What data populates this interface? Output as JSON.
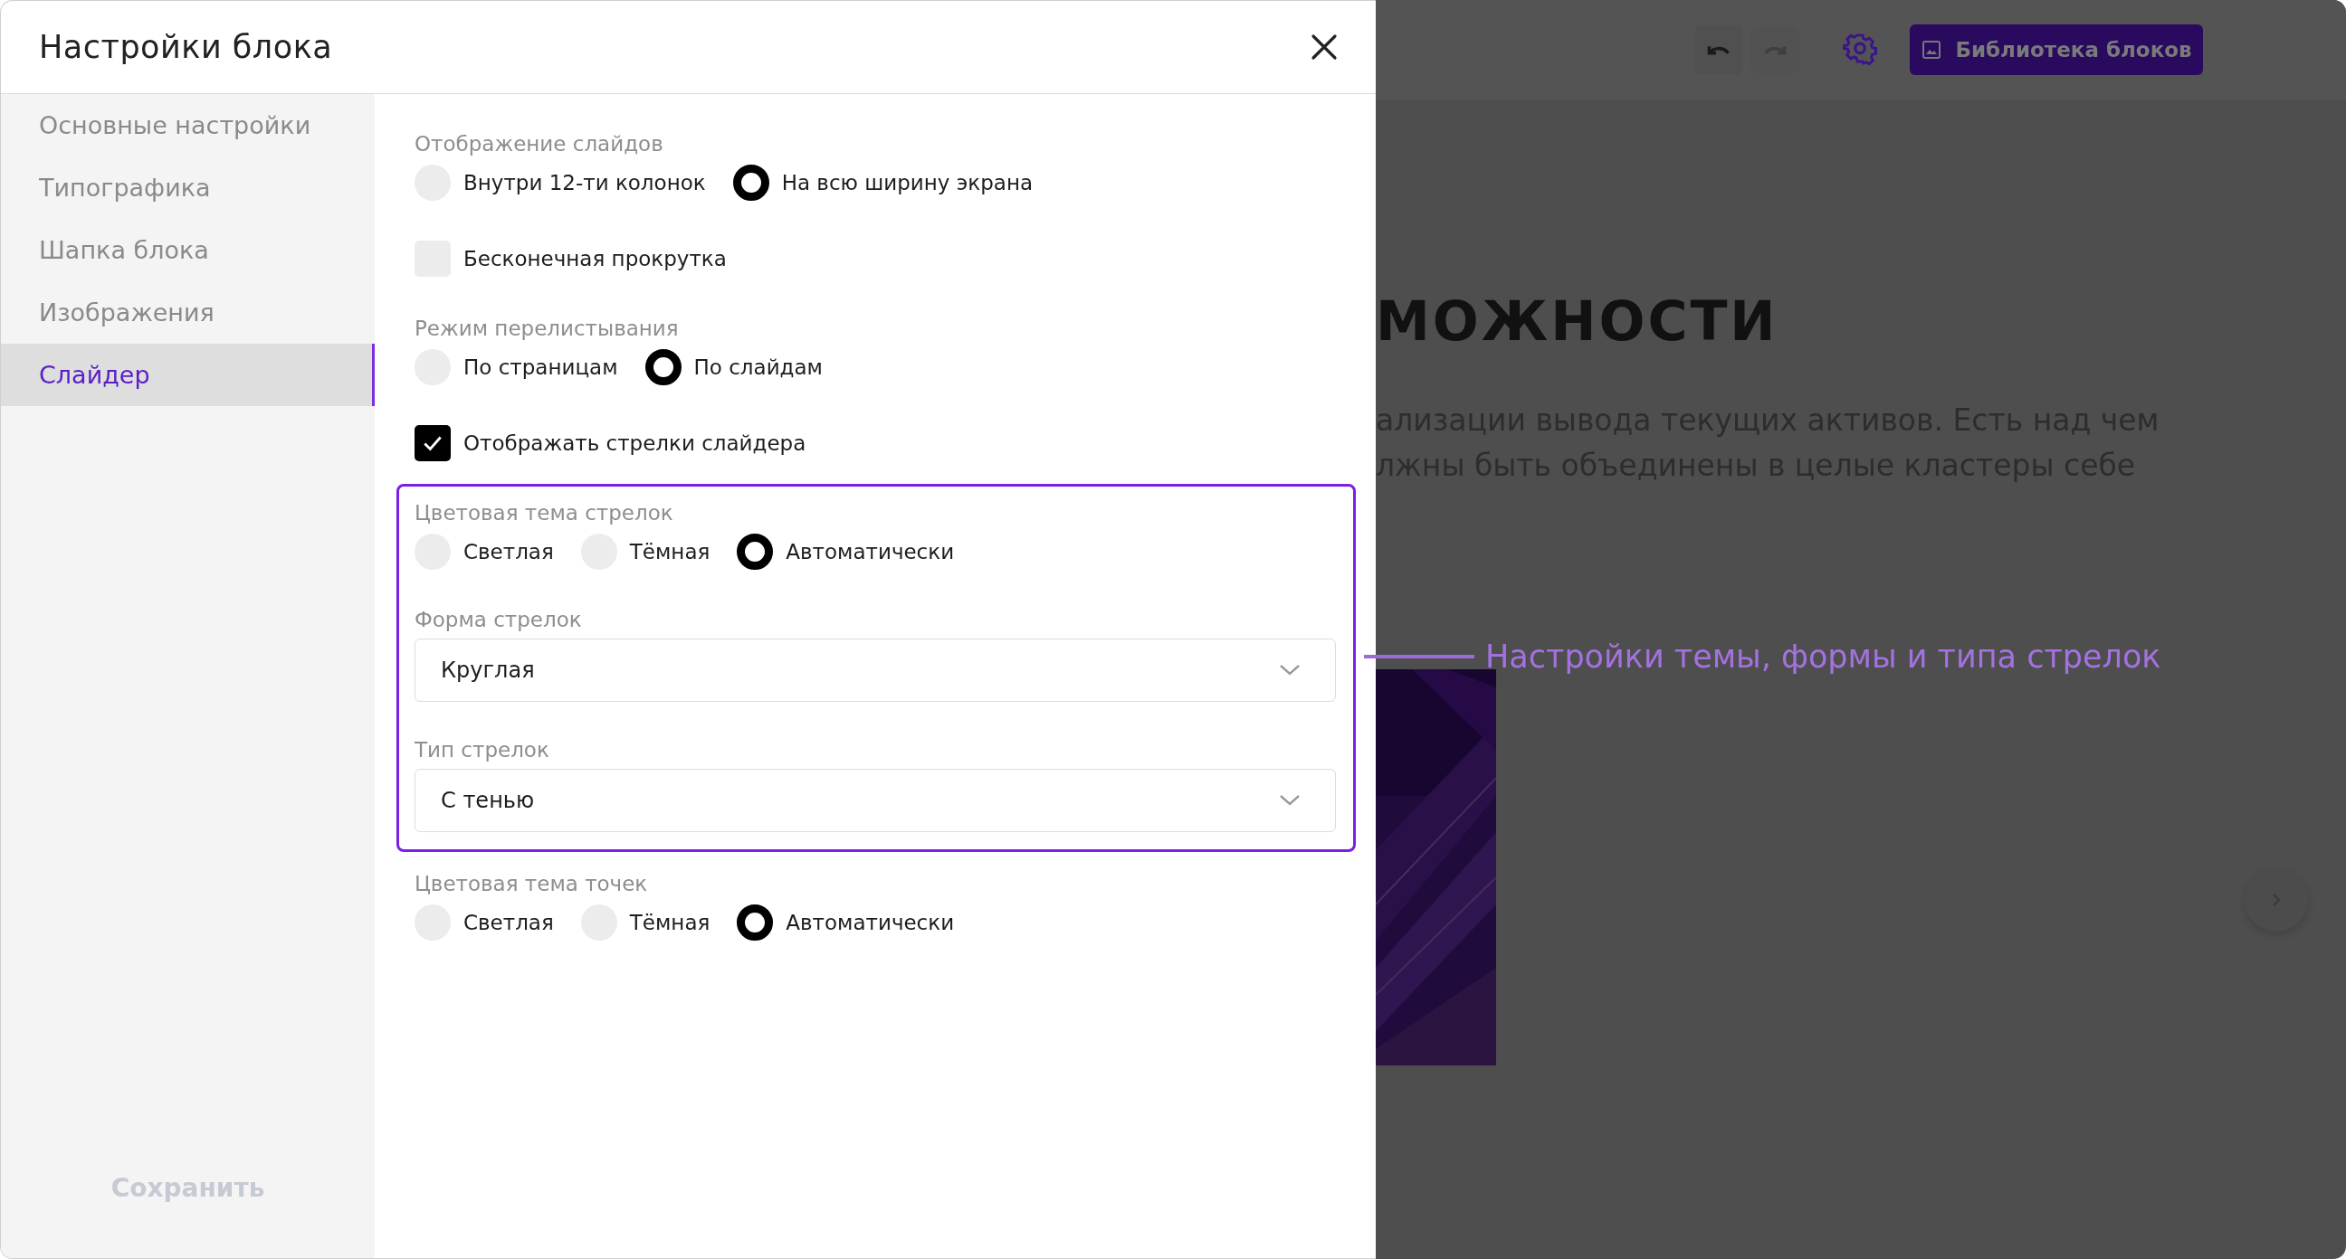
{
  "dialog": {
    "title": "Настройки блока"
  },
  "sidebar": {
    "items": [
      {
        "label": "Основные настройки",
        "selected": false
      },
      {
        "label": "Типографика",
        "selected": false
      },
      {
        "label": "Шапка блока",
        "selected": false
      },
      {
        "label": "Изображения",
        "selected": false
      },
      {
        "label": "Слайдер",
        "selected": true
      }
    ],
    "save_button": {
      "label": "Сохранить",
      "disabled": true
    }
  },
  "blocks": [
    {
      "kind": "radio_group",
      "label": "Отображение слайдов",
      "options": [
        {
          "label": "Внутри 12-ти колонок",
          "selected": false
        },
        {
          "label": "На всю ширину экрана",
          "selected": true
        }
      ]
    },
    {
      "kind": "checkbox",
      "label": "Бесконечная прокрутка",
      "checked": false
    },
    {
      "kind": "radio_group",
      "label": "Режим перелистывания",
      "options": [
        {
          "label": "По страницам",
          "selected": false
        },
        {
          "label": "По слайдам",
          "selected": true
        }
      ]
    },
    {
      "kind": "checkbox",
      "label": "Отображать стрелки слайдера",
      "checked": true
    },
    {
      "kind": "group",
      "highlighted": true,
      "items": [
        {
          "kind": "radio_group",
          "label": "Цветовая тема стрелок",
          "options": [
            {
              "label": "Светлая",
              "selected": false
            },
            {
              "label": "Тёмная",
              "selected": false
            },
            {
              "label": "Автоматически",
              "selected": true
            }
          ]
        },
        {
          "kind": "select",
          "label": "Форма стрелок",
          "value": "Круглая"
        },
        {
          "kind": "select",
          "label": "Тип стрелок",
          "value": "С тенью"
        }
      ]
    },
    {
      "kind": "radio_group",
      "label": "Цветовая тема точек",
      "options": [
        {
          "label": "Светлая",
          "selected": false
        },
        {
          "label": "Тёмная",
          "selected": false
        },
        {
          "label": "Автоматически",
          "selected": true
        }
      ]
    }
  ],
  "page_preview": {
    "toolbar": {
      "buttons": [
        {
          "kind": "undo",
          "disabled": false
        },
        {
          "kind": "redo",
          "disabled": true
        }
      ],
      "library_button": "Библиотека блоков"
    },
    "heading": "МОЖНОСТИ",
    "paragraph": "ализации вывода текущих активов. Есть над чем\nлжны быть объединены в целые кластеры себе"
  },
  "annotation": {
    "text": "Настройки темы, формы и типа стрелок"
  }
}
